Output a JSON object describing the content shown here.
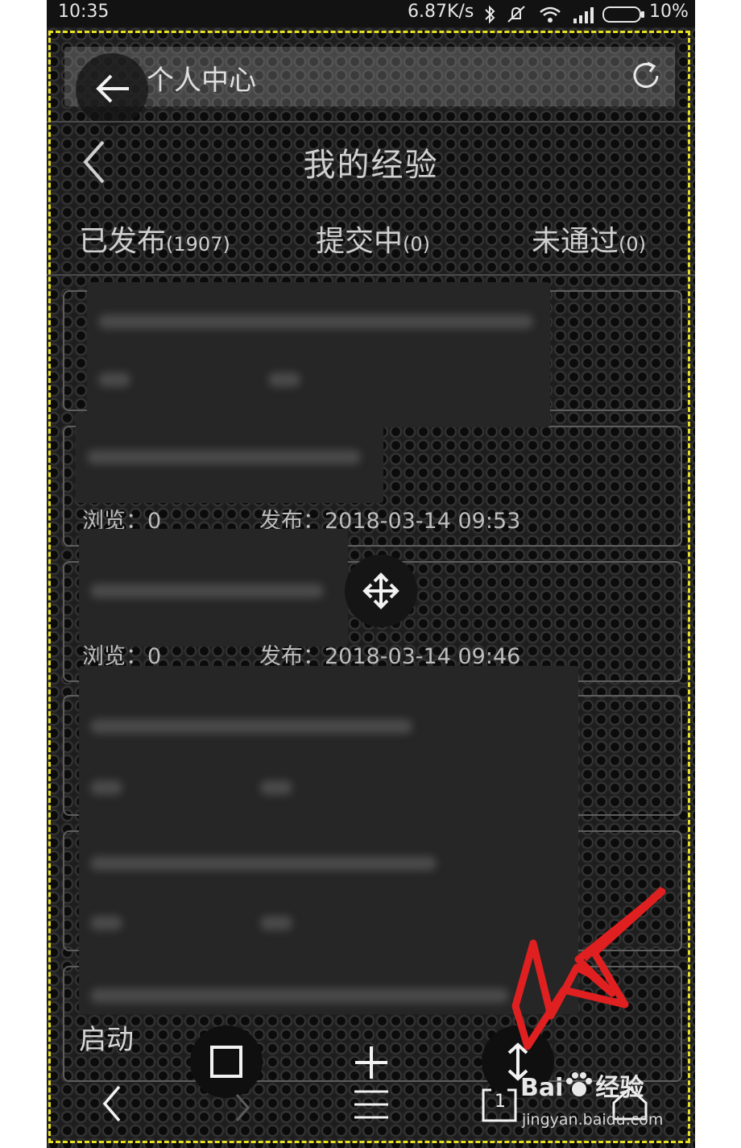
{
  "status_bar": {
    "time": "10:35",
    "net_speed": "6.87K/s",
    "icons": [
      "bluetooth-icon",
      "mute-icon",
      "wifi-icon",
      "signal-icon",
      "battery-icon"
    ],
    "battery": "10%"
  },
  "url_bar": {
    "title": "个人中心",
    "back_icon": "arrow-left-icon",
    "refresh_icon": "refresh-icon"
  },
  "header": {
    "title": "我的经验",
    "back_icon": "chevron-left-icon"
  },
  "tabs": [
    {
      "label": "已发布",
      "count": "(1907)"
    },
    {
      "label": "提交中",
      "count": "(0)"
    },
    {
      "label": "未通过",
      "count": "(0)"
    }
  ],
  "items": [
    {
      "views": "浏览：0",
      "published": "发布：2018-03-14 09:53"
    },
    {
      "views": "浏览：0",
      "published": "发布：2018-03-14 09:46"
    }
  ],
  "toolbar": {
    "launch_label": "启动",
    "tab_count": "1"
  },
  "watermark": {
    "brand": "Bai",
    "brand2": "经验",
    "url": "jingyan.baidu.com"
  },
  "colors": {
    "dash_frame": "#e8e021",
    "arrow": "#e02020",
    "text": "#cfcfcf"
  }
}
